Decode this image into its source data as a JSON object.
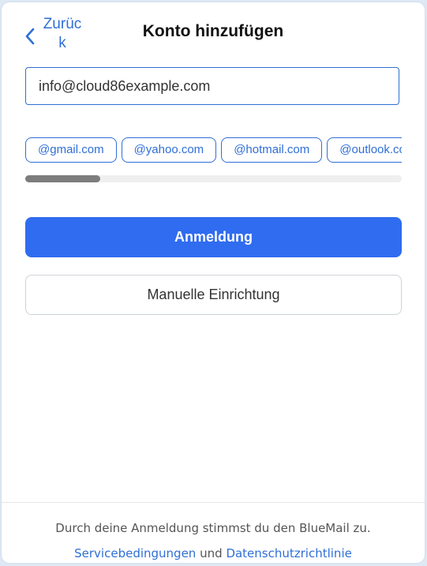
{
  "header": {
    "back_label": "Zurück",
    "title": "Konto hinzufügen"
  },
  "email": {
    "value": "info@cloud86example.com"
  },
  "domains": [
    "@gmail.com",
    "@yahoo.com",
    "@hotmail.com",
    "@outlook.com"
  ],
  "domains_scroll_position": 0.2,
  "buttons": {
    "login_label": "Anmeldung",
    "manual_label": "Manuelle Einrichtung"
  },
  "footer": {
    "consent_text": "Durch deine Anmeldung stimmst du den BlueMail zu.",
    "terms_label": "Servicebedingungen",
    "and_text": "und",
    "privacy_label": "Datenschutzrichtlinie"
  },
  "colors": {
    "accent": "#2f6fd6",
    "primary_button": "#2f6cf0"
  }
}
